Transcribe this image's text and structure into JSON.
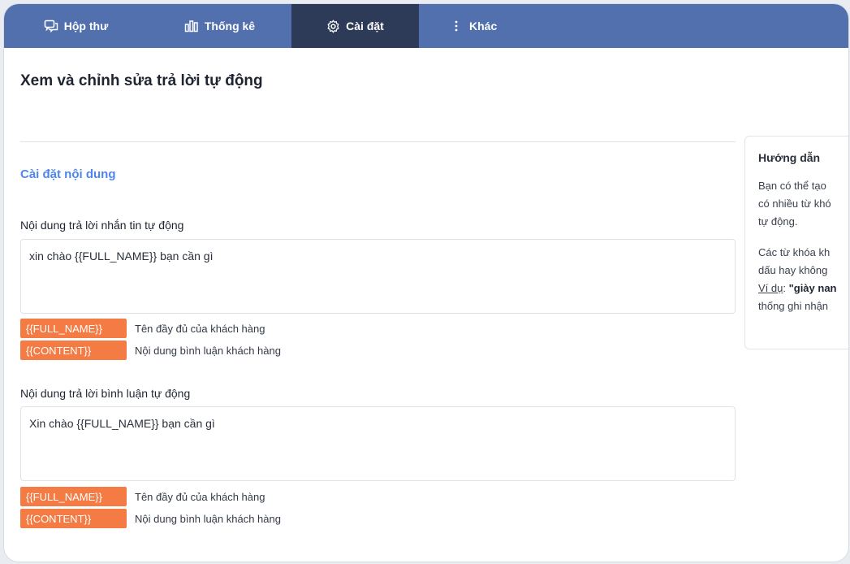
{
  "nav": {
    "tabs": [
      {
        "label": "Hộp thư",
        "icon": "chat-icon"
      },
      {
        "label": "Thống kê",
        "icon": "bar-chart-icon"
      },
      {
        "label": "Cài đặt",
        "icon": "gear-icon",
        "active": true
      },
      {
        "label": "Khác",
        "icon": "more-vertical-icon"
      }
    ]
  },
  "page": {
    "title": "Xem và chỉnh sửa trả lời tự động",
    "section_title": "Cài đặt nội dung"
  },
  "message_reply": {
    "label": "Nội dung trả lời nhắn tin tự động",
    "value": "xin chào {{FULL_NAME}} bạn cần gì",
    "tags": [
      {
        "tag": "{{FULL_NAME}}",
        "desc": "Tên đầy đủ của khách hàng"
      },
      {
        "tag": "{{CONTENT}}",
        "desc": "Nội dung bình luận khách hàng"
      }
    ]
  },
  "comment_reply": {
    "label": "Nội dung trả lời bình luận tự động",
    "value": "Xin chào {{FULL_NAME}} bạn cần gì",
    "tags": [
      {
        "tag": "{{FULL_NAME}}",
        "desc": "Tên đầy đủ của khách hàng"
      },
      {
        "tag": "{{CONTENT}}",
        "desc": "Nội dung bình luận khách hàng"
      }
    ]
  },
  "guide": {
    "title": "Hướng dẫn",
    "p1": [
      "Bạn có thể tạo",
      "có nhiều từ khó",
      "tự động."
    ],
    "p2_l1": "Các từ khóa kh",
    "p2_l2": "dấu hay không",
    "p2_l3_underline": "Ví dụ",
    "p2_l3_colon": ": ",
    "p2_l3_bold": "\"giày nan",
    "p2_l4": "thống ghi nhận"
  },
  "colors": {
    "nav_bg": "#5170ad",
    "nav_active": "#2d3a58",
    "section_title": "#4f86ee",
    "tag_bg": "#f47b43"
  }
}
